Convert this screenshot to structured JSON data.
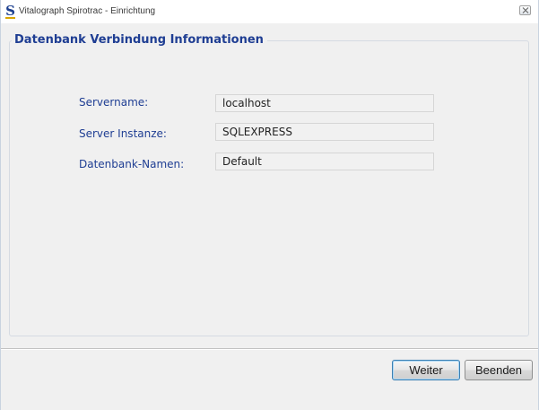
{
  "window": {
    "title": "Vitalograph Spirotrac - Einrichtung",
    "icon": "spirotrac-s-icon",
    "close_icon": "close-icon"
  },
  "group": {
    "title": "Datenbank Verbindung Informationen"
  },
  "fields": [
    {
      "label": "Servername:",
      "value": "localhost"
    },
    {
      "label": "Server Instanze:",
      "value": "SQLEXPRESS"
    },
    {
      "label": "Datenbank-Namen:",
      "value": "Default"
    }
  ],
  "buttons": {
    "next_label": "Weiter",
    "exit_label": "Beenden"
  },
  "colors": {
    "label_blue": "#1f3e93",
    "window_bg": "#f0f0f0",
    "default_button_border": "#3c7fb1"
  }
}
